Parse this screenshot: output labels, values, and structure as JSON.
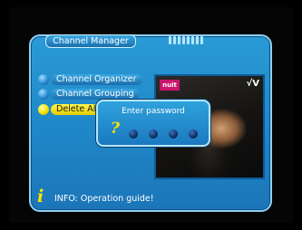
{
  "window": {
    "title": "Channel Manager"
  },
  "menu": {
    "items": [
      {
        "label": "Channel Organizer",
        "selected": false
      },
      {
        "label": "Channel Grouping",
        "selected": false
      },
      {
        "label": "Delete All",
        "selected": true
      }
    ]
  },
  "preview": {
    "channel_logo": "nuit",
    "channel_mark": "√V"
  },
  "dialog": {
    "title": "Enter password",
    "question_glyph": "?",
    "pin_length": 4
  },
  "footer": {
    "info_glyph": "i",
    "info_text": "INFO: Operation guide!"
  },
  "colors": {
    "panel": "#1f86c7",
    "selected": "#f6e200",
    "border": "#8fd0f2"
  }
}
